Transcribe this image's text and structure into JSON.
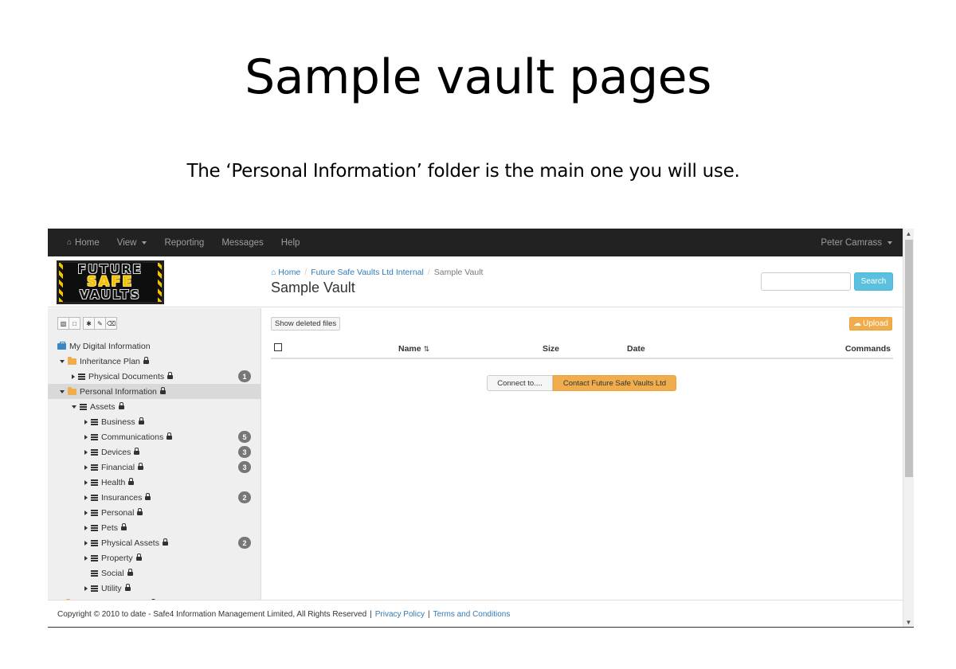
{
  "slide": {
    "title": "Sample vault pages",
    "subtitle": "The ‘Personal Information’ folder is the main one you will use."
  },
  "navbar": {
    "items": [
      {
        "label": "Home",
        "icon": "home-icon"
      },
      {
        "label": "View",
        "dropdown": true
      },
      {
        "label": "Reporting"
      },
      {
        "label": "Messages"
      },
      {
        "label": "Help"
      }
    ],
    "user": "Peter Camrass"
  },
  "logo": {
    "line1": "FUTURE",
    "line2": "SAFE",
    "line3": "VAULTS"
  },
  "breadcrumb": {
    "home": "Home",
    "org": "Future Safe Vaults Ltd Internal",
    "current": "Sample Vault"
  },
  "page_title": "Sample Vault",
  "search": {
    "value": "",
    "button": "Search"
  },
  "sidebar": {
    "toolbar_icons": [
      "folder-open-icon",
      "folder-icon",
      "asterisk-icon",
      "edit-icon",
      "trash-icon"
    ],
    "tree": [
      {
        "label": "My Digital Information",
        "icon": "briefcase",
        "toggle": "none",
        "level": 0,
        "lock": false
      },
      {
        "label": "Inheritance Plan",
        "icon": "folder",
        "toggle": "down",
        "level": 0,
        "lock": true
      },
      {
        "label": "Physical Documents",
        "icon": "list",
        "toggle": "right",
        "level": 1,
        "lock": true,
        "badge": "1"
      },
      {
        "label": "Personal Information",
        "icon": "folder",
        "toggle": "down",
        "level": 0,
        "lock": true,
        "selected": true
      },
      {
        "label": "Assets",
        "icon": "list",
        "toggle": "down",
        "level": 1,
        "lock": true
      },
      {
        "label": "Business",
        "icon": "list",
        "toggle": "right",
        "level": 2,
        "lock": true
      },
      {
        "label": "Communications",
        "icon": "list",
        "toggle": "right",
        "level": 2,
        "lock": true,
        "badge": "5"
      },
      {
        "label": "Devices",
        "icon": "list",
        "toggle": "right",
        "level": 2,
        "lock": true,
        "badge": "3"
      },
      {
        "label": "Financial",
        "icon": "list",
        "toggle": "right",
        "level": 2,
        "lock": true,
        "badge": "3"
      },
      {
        "label": "Health",
        "icon": "list",
        "toggle": "right",
        "level": 2,
        "lock": true
      },
      {
        "label": "Insurances",
        "icon": "list",
        "toggle": "right",
        "level": 2,
        "lock": true,
        "badge": "2"
      },
      {
        "label": "Personal",
        "icon": "list",
        "toggle": "right",
        "level": 2,
        "lock": true
      },
      {
        "label": "Pets",
        "icon": "list",
        "toggle": "right",
        "level": 2,
        "lock": true
      },
      {
        "label": "Physical Assets",
        "icon": "list",
        "toggle": "right",
        "level": 2,
        "lock": true,
        "badge": "2"
      },
      {
        "label": "Property",
        "icon": "list",
        "toggle": "right",
        "level": 2,
        "lock": true
      },
      {
        "label": "Social",
        "icon": "list",
        "toggle": "none",
        "level": 2,
        "lock": true
      },
      {
        "label": "Utility",
        "icon": "list",
        "toggle": "right",
        "level": 2,
        "lock": true
      },
      {
        "label": "Family Documents",
        "icon": "folder",
        "toggle": "right",
        "level": 0,
        "lock": true
      }
    ]
  },
  "main": {
    "show_deleted": "Show deleted files",
    "upload": "Upload",
    "columns": {
      "name": "Name",
      "size": "Size",
      "date": "Date",
      "commands": "Commands"
    },
    "connect": "Connect to....",
    "contact": "Contact Future Safe Vaults Ltd"
  },
  "footer": {
    "copyright": "Copyright © 2010 to date - Safe4 Information Management Limited, All Rights Reserved",
    "sep1": "|",
    "privacy": "Privacy Policy",
    "sep2": "|",
    "terms": "Terms and Conditions"
  },
  "colors": {
    "navbar": "#222222",
    "link": "#337ab7",
    "search_button": "#5bc0de",
    "warning": "#f0ad4e",
    "badge": "#777777"
  }
}
